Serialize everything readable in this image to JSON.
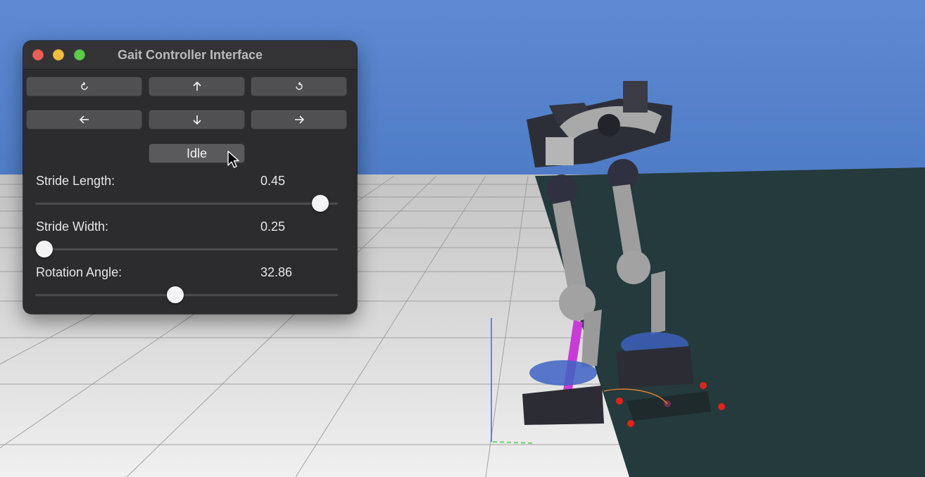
{
  "window": {
    "title": "Gait Controller Interface"
  },
  "controls": {
    "buttons": [
      {
        "name": "rotate-left-button",
        "icon": "rotate-ccw-icon"
      },
      {
        "name": "forward-button",
        "icon": "arrow-up-icon"
      },
      {
        "name": "rotate-right-button",
        "icon": "rotate-cw-icon"
      },
      {
        "name": "left-button",
        "icon": "arrow-left-icon"
      },
      {
        "name": "backward-button",
        "icon": "arrow-down-icon"
      },
      {
        "name": "right-button",
        "icon": "arrow-right-icon"
      }
    ],
    "mode_label": "Idle"
  },
  "sliders": [
    {
      "label": "Stride Length:",
      "value": "0.45",
      "fraction": 0.97
    },
    {
      "label": "Stride Width:",
      "value": "0.25",
      "fraction": 0.0
    },
    {
      "label": "Rotation Angle:",
      "value": "32.86",
      "fraction": 0.46
    }
  ],
  "colors": {
    "sky": "#5b86cf",
    "panel": "#2c2c2e",
    "dark_floor": "#243a3c",
    "marker": "#e0241b",
    "magenta": "#c93bd6"
  }
}
